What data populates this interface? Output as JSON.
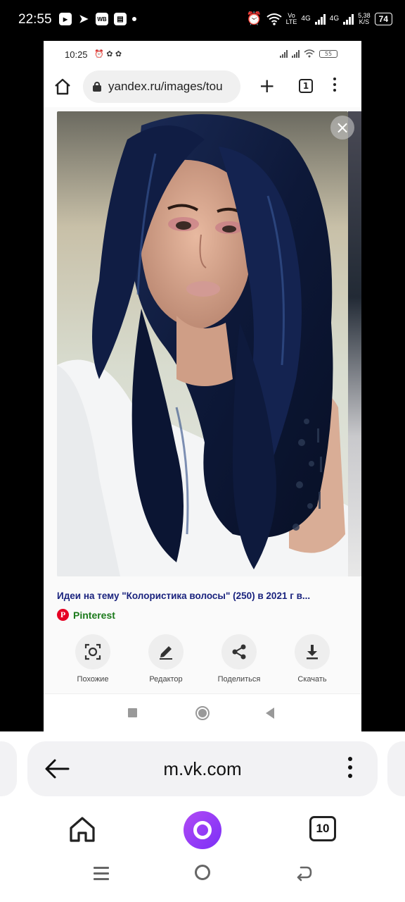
{
  "status_bar": {
    "time": "22:55",
    "icons": [
      "youtube-icon",
      "telegram-icon",
      "wb-icon",
      "radio-icon"
    ],
    "wb_label": "WB",
    "net_label_1": "Vo",
    "net_label_2": "LTE",
    "net_4g_a": "4G",
    "net_4g_b": "4G",
    "speed_value": "5,38",
    "speed_unit": "K/S",
    "battery": "74"
  },
  "inner_screen": {
    "status": {
      "time": "10:25",
      "battery": "55"
    },
    "toolbar": {
      "url": "yandex.ru/images/tou",
      "tabs_count": "1"
    },
    "image_card": {
      "caption": "Идеи на тему \"Колористика волосы\" (250) в 2021 г в...",
      "source_name": "Pinterest",
      "source_logo_letter": "P"
    },
    "actions": [
      {
        "label": "Похожие",
        "icon": "lens-icon"
      },
      {
        "label": "Редактор",
        "icon": "pencil-icon"
      },
      {
        "label": "Поделиться",
        "icon": "share-icon"
      },
      {
        "label": "Скачать",
        "icon": "download-icon"
      }
    ]
  },
  "outer_browser": {
    "address": "m.vk.com",
    "tabs_count": "10"
  },
  "colors": {
    "caption": "#1a237e",
    "source": "#1b7a1b",
    "pinterest": "#e60023",
    "alice": "#8a3cf5"
  }
}
